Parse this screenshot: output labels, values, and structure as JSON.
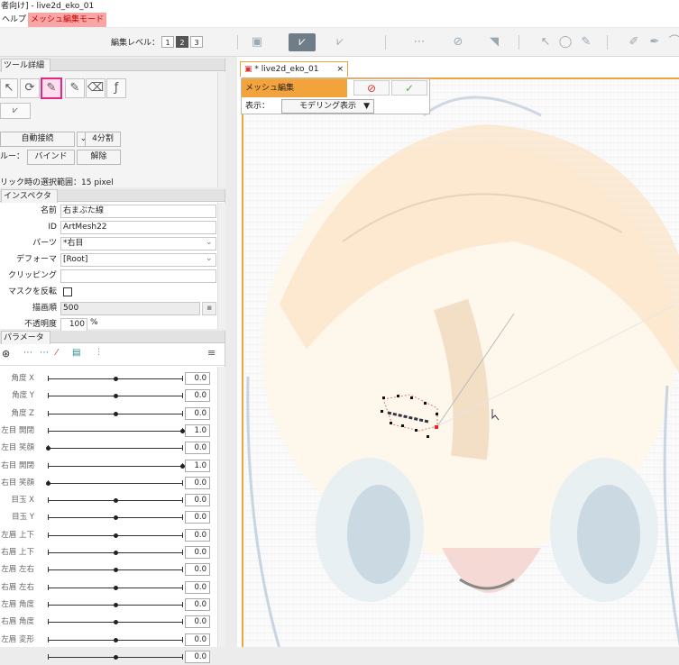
{
  "title": "者向け] - live2d_eko_01",
  "menu": {
    "help": "ヘルプ",
    "mode": "メッシュ編集モード"
  },
  "toolbar": {
    "edit_level_label": "編集レベル：",
    "levels": [
      "1",
      "2",
      "3"
    ],
    "active_level": "2"
  },
  "tool_panel": {
    "header": "ツール詳細",
    "auto_connect": "自動接続",
    "divide": "4分割",
    "group_label": "ルー：",
    "bind": "バインド",
    "unbind": "解除",
    "selection_range": "リック時の選択範囲：15 pixel"
  },
  "inspector": {
    "header": "インスペクタ",
    "rows": [
      {
        "label": "名前",
        "value": "右まぶた線",
        "type": "text"
      },
      {
        "label": "ID",
        "value": "ArtMesh22",
        "type": "text"
      },
      {
        "label": "パーツ",
        "value": "*右目",
        "type": "select"
      },
      {
        "label": "デフォーマ",
        "value": "[Root]",
        "type": "select"
      },
      {
        "label": "クリッピング",
        "value": "",
        "type": "text"
      },
      {
        "label": "マスクを反転",
        "value": "",
        "type": "check"
      },
      {
        "label": "描画順",
        "value": "500",
        "type": "number"
      },
      {
        "label": "不透明度",
        "value": "100",
        "type": "percent"
      }
    ],
    "percent_unit": "%"
  },
  "parameters": {
    "header": "パラメータ",
    "items": [
      {
        "label": "角度 X",
        "value": "0.0",
        "pos": 0.5
      },
      {
        "label": "角度 Y",
        "value": "0.0",
        "pos": 0.5
      },
      {
        "label": "角度 Z",
        "value": "0.0",
        "pos": 0.5
      },
      {
        "label": "左目 開閉",
        "value": "1.0",
        "pos": 1.0
      },
      {
        "label": "左目 笑顔",
        "value": "0.0",
        "pos": 0.0
      },
      {
        "label": "右目 開閉",
        "value": "1.0",
        "pos": 1.0
      },
      {
        "label": "右目 笑顔",
        "value": "0.0",
        "pos": 0.0
      },
      {
        "label": "目玉 X",
        "value": "0.0",
        "pos": 0.5
      },
      {
        "label": "目玉 Y",
        "value": "0.0",
        "pos": 0.5
      },
      {
        "label": "左眉 上下",
        "value": "0.0",
        "pos": 0.5
      },
      {
        "label": "右眉 上下",
        "value": "0.0",
        "pos": 0.5
      },
      {
        "label": "左眉 左右",
        "value": "0.0",
        "pos": 0.5
      },
      {
        "label": "右眉 左右",
        "value": "0.0",
        "pos": 0.5
      },
      {
        "label": "左眉 角度",
        "value": "0.0",
        "pos": 0.5
      },
      {
        "label": "右眉 角度",
        "value": "0.0",
        "pos": 0.5
      },
      {
        "label": "左眉 変形",
        "value": "0.0",
        "pos": 0.5
      },
      {
        "label": "",
        "value": "0.0",
        "pos": 0.5
      }
    ]
  },
  "document": {
    "tab_label": "* live2d_eko_01",
    "mesh_edit_label": "メッシュ編集",
    "display_label": "表示：",
    "display_mode": "モデリング表示"
  },
  "colors": {
    "accent": "#f3a33c",
    "mode": "#f7a5a5",
    "selected_tool": "#e0297f"
  }
}
